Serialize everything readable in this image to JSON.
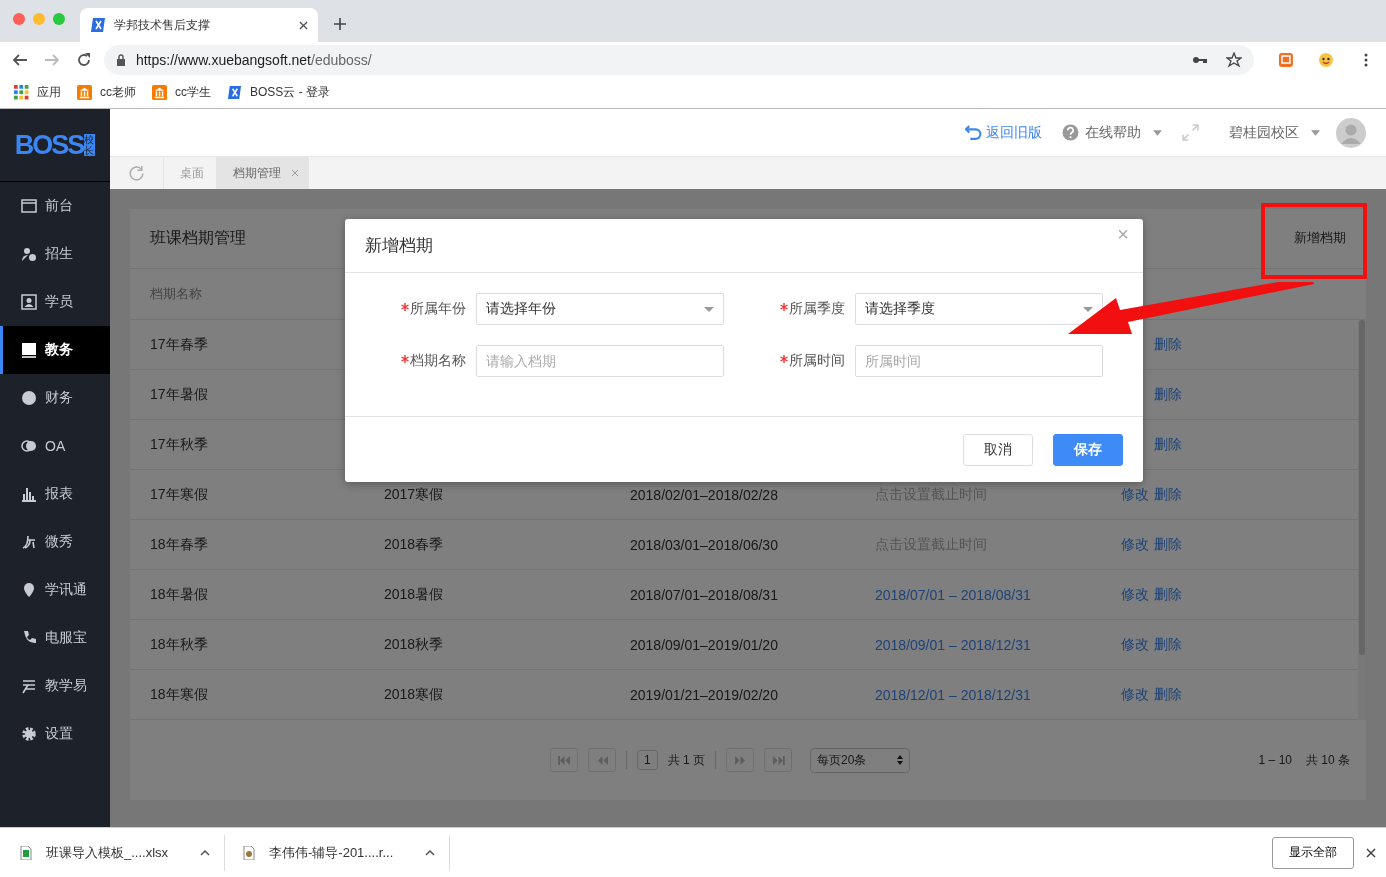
{
  "browser": {
    "tabs": [
      {
        "title": "学邦技术售后支撑",
        "selected": true
      }
    ],
    "url_host": "https://www.xuebangsoft.net",
    "url_path": "/eduboss/",
    "bookmarks": [
      {
        "label": "应用",
        "kind": "apps"
      },
      {
        "label": "cc老师",
        "kind": "bank"
      },
      {
        "label": "cc学生",
        "kind": "bank"
      },
      {
        "label": "BOSS云 - 登录",
        "kind": "x"
      }
    ]
  },
  "logo": {
    "main": "BOSS",
    "sub": "校长"
  },
  "header": {
    "back_link": "返回旧版",
    "help": "在线帮助",
    "campus": "碧桂园校区"
  },
  "page_tabs": [
    {
      "label": "桌面",
      "selected": false,
      "closable": false
    },
    {
      "label": "档期管理",
      "selected": true,
      "closable": true
    }
  ],
  "sidebar": {
    "items": [
      {
        "label": "前台",
        "selected": false
      },
      {
        "label": "招生",
        "selected": false
      },
      {
        "label": "学员",
        "selected": false
      },
      {
        "label": "教务",
        "selected": true
      },
      {
        "label": "财务",
        "selected": false
      },
      {
        "label": "OA",
        "selected": false
      },
      {
        "label": "报表",
        "selected": false
      },
      {
        "label": "微秀",
        "selected": false
      },
      {
        "label": "学讯通",
        "selected": false
      },
      {
        "label": "电服宝",
        "selected": false
      },
      {
        "label": "教学易",
        "selected": false
      },
      {
        "label": "设置",
        "selected": false
      }
    ]
  },
  "card": {
    "title": "班课档期管理",
    "add_button": "新增档期",
    "columns": [
      "档期名称"
    ],
    "rows": [
      {
        "name": "17年春季",
        "actions": [
          "删除"
        ]
      },
      {
        "name": "17年暑假",
        "actions": [
          "删除"
        ]
      },
      {
        "name": "17年秋季",
        "actions": [
          "删除"
        ]
      },
      {
        "name": "17年寒假",
        "season": "2017寒假",
        "dates": "2018/02/01–2018/02/28",
        "deadline": {
          "text": "点击设置截止时间",
          "kind": "hint"
        },
        "actions": [
          "修改",
          "删除"
        ]
      },
      {
        "name": "18年春季",
        "season": "2018春季",
        "dates": "2018/03/01–2018/06/30",
        "deadline": {
          "text": "点击设置截止时间",
          "kind": "hint"
        },
        "actions": [
          "修改",
          "删除"
        ]
      },
      {
        "name": "18年暑假",
        "season": "2018暑假",
        "dates": "2018/07/01–2018/08/31",
        "deadline": {
          "text": "2018/07/01 – 2018/08/31",
          "kind": "link"
        },
        "actions": [
          "修改",
          "删除"
        ]
      },
      {
        "name": "18年秋季",
        "season": "2018秋季",
        "dates": "2018/09/01–2019/01/20",
        "deadline": {
          "text": "2018/09/01 – 2018/12/31",
          "kind": "link"
        },
        "actions": [
          "修改",
          "删除"
        ]
      },
      {
        "name": "18年寒假",
        "season": "2018寒假",
        "dates": "2019/01/21–2019/02/20",
        "deadline": {
          "text": "2018/12/01 – 2018/12/31",
          "kind": "link"
        },
        "actions": [
          "修改",
          "删除"
        ]
      }
    ],
    "pagination": {
      "page": "1",
      "total_pages": "共 1 页",
      "per_page": "每页20条",
      "range": "1 – 10",
      "total": "共 10 条"
    }
  },
  "modal": {
    "title": "新增档期",
    "close": "×",
    "fields": [
      {
        "label": "所属年份",
        "required": true,
        "kind": "select",
        "placeholder": "请选择年份"
      },
      {
        "label": "所属季度",
        "required": true,
        "kind": "select",
        "placeholder": "请选择季度"
      },
      {
        "label": "档期名称",
        "required": true,
        "kind": "input",
        "placeholder": "请输入档期"
      },
      {
        "label": "所属时间",
        "required": true,
        "kind": "input",
        "placeholder": "所属时间"
      }
    ],
    "cancel": "取消",
    "save": "保存"
  },
  "downloads": {
    "items": [
      {
        "name": "班课导入模板_....xlsx",
        "kind": "sheet"
      },
      {
        "name": "李伟伟-辅导-201....r...",
        "kind": "doc"
      }
    ],
    "show_all": "显示全部"
  }
}
